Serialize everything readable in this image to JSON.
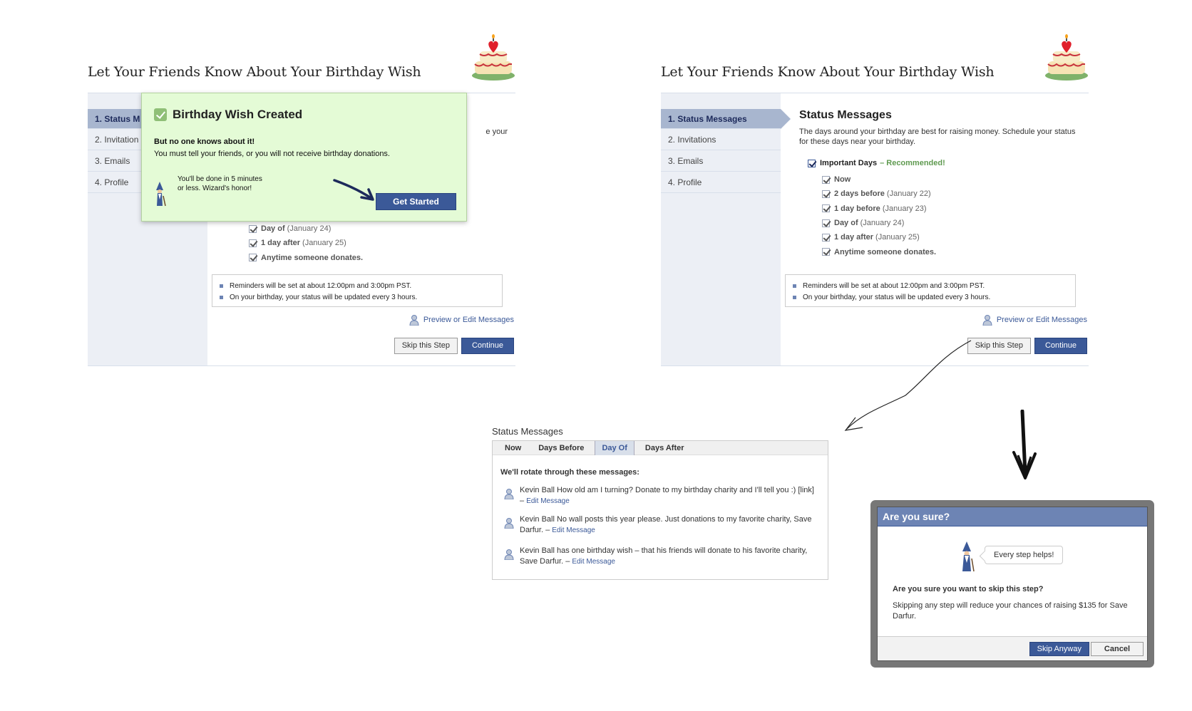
{
  "panel_left": {
    "title": "Let Your Friends Know About Your Birthday Wish",
    "steps": [
      "1. Status M",
      "2. Invitation",
      "3. Emails",
      "4. Profile"
    ],
    "desc_fragment": "e your",
    "checkboxes": [
      {
        "label": "Day of",
        "sub": "(January 24)"
      },
      {
        "label": "1 day after",
        "sub": "(January 25)"
      },
      {
        "label": "Anytime someone donates.",
        "sub": ""
      }
    ]
  },
  "panel_right": {
    "title": "Let Your Friends Know About Your Birthday Wish",
    "steps": [
      "1. Status Messages",
      "2. Invitations",
      "3. Emails",
      "4. Profile"
    ],
    "section_title": "Status Messages",
    "description": "The days around your birthday are best for raising money. Schedule your status for these days near your birthday.",
    "important_label": "Important Days",
    "recommended": "– Recommended!",
    "checkboxes": [
      {
        "label": "Now",
        "sub": ""
      },
      {
        "label": "2 days before",
        "sub": "(January 22)"
      },
      {
        "label": "1 day before",
        "sub": "(January 23)"
      },
      {
        "label": "Day of",
        "sub": "(January 24)"
      },
      {
        "label": "1 day after",
        "sub": "(January 25)"
      },
      {
        "label": "Anytime someone donates.",
        "sub": ""
      }
    ]
  },
  "info": {
    "reminder": "Reminders will be set at about 12:00pm and 3:00pm PST.",
    "birthday": "On your birthday, your status will be updated every 3 hours."
  },
  "preview_link": "Preview or Edit Messages",
  "buttons": {
    "skip": "Skip this Step",
    "continue": "Continue"
  },
  "popup": {
    "title": "Birthday Wish Created",
    "heading": "But no one knows about it!",
    "text": "You must tell your friends, or you will not receive birthday donations.",
    "wizard_note_1": "You'll be done in 5 minutes",
    "wizard_note_2": "or less. Wizard's honor!",
    "button": "Get Started"
  },
  "status_messages": {
    "title": "Status Messages",
    "tabs": [
      "Now",
      "Days Before",
      "Day Of",
      "Days After"
    ],
    "active_tab": "Day Of",
    "intro": "We'll rotate through these messages:",
    "edit_label": "Edit Message",
    "messages": [
      "Kevin Ball How old am I turning? Donate to my birthday charity and I'll tell you :) [link] –",
      "Kevin Ball No wall posts this year please. Just donations to my favorite charity, Save Darfur. –",
      "Kevin Ball has one birthday wish – that his friends will donate to his favorite charity, Save Darfur. –"
    ]
  },
  "dialog": {
    "title": "Are you sure?",
    "bubble": "Every step helps!",
    "question": "Are you sure you want to skip this step?",
    "text": "Skipping any step will reduce your chances of raising $135 for Save Darfur.",
    "skip": "Skip Anyway",
    "cancel": "Cancel"
  },
  "colors": {
    "fb_blue": "#3b5998",
    "sidebar": "#eceff5",
    "popup_green": "#e4fbd6",
    "recommended": "#5f9a50"
  },
  "icons": [
    "cake-icon",
    "check-icon",
    "wizard-icon",
    "person-icon",
    "arrow-icon"
  ]
}
